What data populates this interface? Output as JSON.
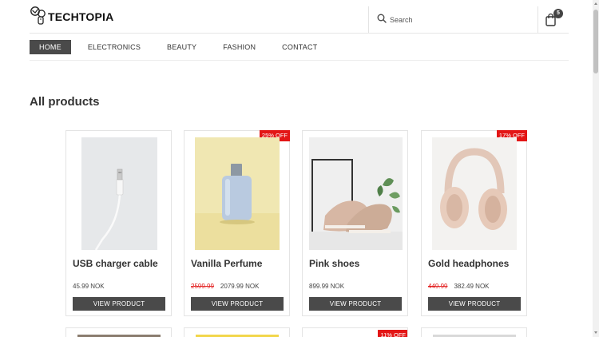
{
  "header": {
    "logo_text": "TECHTOPIA",
    "search_placeholder": "Search",
    "cart_count": "5"
  },
  "nav": {
    "items": [
      "HOME",
      "ELECTRONICS",
      "BEAUTY",
      "FASHION",
      "CONTACT"
    ],
    "active": "HOME"
  },
  "main": {
    "title": "All products"
  },
  "products": [
    {
      "name": "USB charger cable",
      "price": "45.99 NOK",
      "old_price": "",
      "badge": "",
      "button": "VIEW PRODUCT"
    },
    {
      "name": "Vanilla Perfume",
      "price": "2079.99 NOK",
      "old_price": "2599.99",
      "badge": "25% OFF",
      "button": "VIEW PRODUCT"
    },
    {
      "name": "Pink shoes",
      "price": "899.99 NOK",
      "old_price": "",
      "badge": "",
      "button": "VIEW PRODUCT"
    },
    {
      "name": "Gold headphones",
      "price": "382.49 NOK",
      "old_price": "449.99",
      "badge": "17% OFF",
      "button": "VIEW PRODUCT"
    }
  ],
  "next_row": {
    "badge_3": "11% OFF"
  },
  "colors": {
    "dark_button": "#4a4a4a",
    "sale_badge": "#e31616",
    "old_price": "#e21c1c"
  }
}
